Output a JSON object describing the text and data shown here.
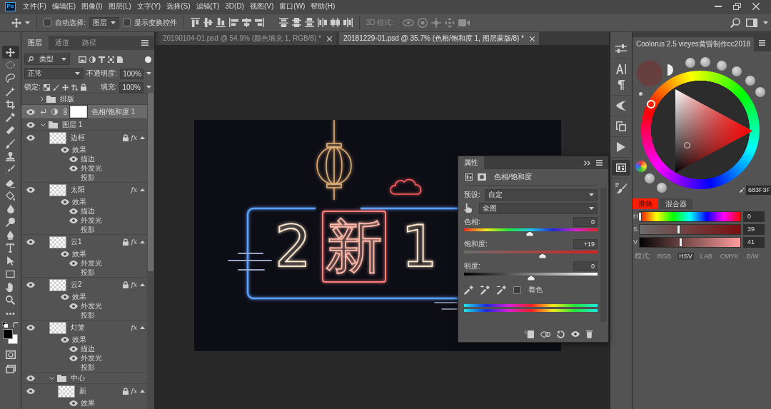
{
  "menu_bar": {
    "logo": "Ps",
    "items": [
      "文件(F)",
      "编辑(E)",
      "图像(I)",
      "图层(L)",
      "文字(Y)",
      "选择(S)",
      "滤镜(T)",
      "3D(D)",
      "视图(V)",
      "窗口(W)",
      "帮助(H)"
    ]
  },
  "options_bar": {
    "auto_select": {
      "label": "自动选择:",
      "checked": false
    },
    "auto_select_target": "图层",
    "transform_controls": {
      "label": "显示变换控件",
      "checked": false
    },
    "mode_3d_label": "3D 模式:"
  },
  "document_tabs": [
    {
      "title": "20190104-01.psd @ 54.9% (颜色填充 1, RGB/8) *",
      "selected": false
    },
    {
      "title": "20181229-01.psd @ 35.7% (色相/饱和度 1, 图层蒙版/8) *",
      "selected": true
    }
  ],
  "tools": [
    {
      "selected": true
    },
    {
      "selected": false
    },
    {
      "selected": false
    },
    {
      "selected": false
    },
    {
      "selected": false
    },
    {
      "selected": false
    },
    {
      "selected": false
    },
    {
      "selected": false
    },
    {
      "selected": false
    },
    {
      "selected": false
    },
    {
      "selected": false
    },
    {
      "selected": false
    },
    {
      "selected": false
    },
    {
      "selected": false
    },
    {
      "selected": false
    },
    {
      "selected": false
    },
    {
      "selected": false
    },
    {
      "selected": false
    },
    {
      "selected": false
    },
    {
      "selected": false
    },
    {
      "selected": false
    }
  ],
  "layers_panel": {
    "tabs": [
      {
        "label": "图层",
        "selected": true
      },
      {
        "label": "通道",
        "selected": false
      },
      {
        "label": "路径",
        "selected": false
      }
    ],
    "filter": "类型",
    "blend_mode": "正常",
    "opacity_label": "不透明度:",
    "opacity": "100%",
    "lock_label": "锁定:",
    "fill_label": "填充:",
    "fill": "100%",
    "layers": [
      {
        "kind": "group",
        "name": "排版",
        "visible": false,
        "selected": false,
        "locked": false,
        "expanded": false
      },
      {
        "kind": "adjustment",
        "name": "色相/饱和度 1",
        "visible": true,
        "selected": true,
        "locked": false
      },
      {
        "kind": "group",
        "name": "图层 1",
        "visible": true,
        "selected": false,
        "locked": false,
        "expanded": true,
        "children": [
          {
            "kind": "layer",
            "name": "边框",
            "visible": true,
            "selected": false,
            "locked": true,
            "expanded": true,
            "badge": "fx",
            "effects": {
              "label": "效果",
              "visible": true,
              "items": [
                {
                  "name": "描边",
                  "visible": true
                },
                {
                  "name": "外发光",
                  "visible": true
                },
                {
                  "name": "投影",
                  "visible": false
                }
              ]
            }
          },
          {
            "kind": "layer",
            "name": "太阳",
            "visible": true,
            "selected": false,
            "locked": false,
            "expanded": true,
            "badge": "fx",
            "effects": {
              "label": "效果",
              "visible": true,
              "items": [
                {
                  "name": "描边",
                  "visible": true
                },
                {
                  "name": "外发光",
                  "visible": true
                },
                {
                  "name": "投影",
                  "visible": false
                }
              ]
            }
          },
          {
            "kind": "layer",
            "name": "云1",
            "visible": true,
            "selected": false,
            "locked": true,
            "expanded": true,
            "badge": "fx",
            "effects": {
              "label": "效果",
              "visible": true,
              "items": [
                {
                  "name": "外发光",
                  "visible": true
                },
                {
                  "name": "投影",
                  "visible": false
                }
              ]
            }
          },
          {
            "kind": "layer",
            "name": "云2",
            "visible": true,
            "selected": false,
            "locked": true,
            "expanded": true,
            "badge": "fx",
            "effects": {
              "label": "效果",
              "visible": true,
              "items": [
                {
                  "name": "外发光",
                  "visible": true
                },
                {
                  "name": "投影",
                  "visible": false
                }
              ]
            }
          },
          {
            "kind": "layer",
            "name": "灯笼",
            "visible": true,
            "selected": false,
            "locked": false,
            "expanded": true,
            "badge": "fx",
            "effects": {
              "label": "效果",
              "visible": true,
              "items": [
                {
                  "name": "描边",
                  "visible": true
                },
                {
                  "name": "外发光",
                  "visible": true
                },
                {
                  "name": "投影",
                  "visible": false
                }
              ]
            }
          },
          {
            "kind": "group",
            "name": "中心",
            "visible": true,
            "selected": false,
            "locked": false,
            "expanded": true,
            "children": [
              {
                "kind": "layer",
                "name": "新",
                "visible": true,
                "selected": false,
                "locked": true,
                "expanded": true,
                "badge": "fx",
                "effects": {
                  "label": "效果",
                  "visible": true
                }
              }
            ]
          }
        ]
      }
    ]
  },
  "canvas": {
    "artwork": [
      {
        "text": "2",
        "framed": false
      },
      {
        "text": "新",
        "framed": true
      },
      {
        "text": "1",
        "framed": false
      }
    ]
  },
  "properties_panel": {
    "title": "属性",
    "view_tabs": [
      {
        "selected": true
      },
      {
        "selected": false
      }
    ],
    "adjustment_title": "色相/饱和度",
    "preset_label": "预设:",
    "preset": "自定",
    "range": "全图",
    "sliders": [
      {
        "kind": "hue",
        "label": "色相:",
        "value": "0",
        "level": 0.49
      },
      {
        "kind": "saturation",
        "label": "饱和度:",
        "value": "+19",
        "level": 0.59
      },
      {
        "kind": "lightness",
        "label": "明度:",
        "value": "0",
        "level": 0.5
      }
    ],
    "colorize": {
      "label": "着色",
      "checked": false
    }
  },
  "dock_icons": [
    {
      "selected": false
    },
    {
      "selected": false
    },
    {
      "selected": false
    },
    {
      "selected": false
    },
    {
      "selected": false
    },
    {
      "selected": false
    },
    {
      "selected": true
    },
    {
      "selected": false
    }
  ],
  "coolorus": {
    "title": "Coolorus 2.5 vieyes黄昏制作cc2018",
    "hex": "683F3F",
    "tabs": [
      {
        "label": "滑块",
        "selected": true
      },
      {
        "label": "混合器",
        "selected": false
      }
    ],
    "sliders": [
      {
        "kind": "hue",
        "label": "H",
        "value": "0",
        "level": 0.01
      },
      {
        "kind": "saturation",
        "label": "S",
        "value": "39",
        "level": 0.39
      },
      {
        "kind": "value",
        "label": "V",
        "value": "41",
        "level": 0.41
      }
    ],
    "modes_label": "模式:",
    "modes": [
      {
        "label": "RGB",
        "selected": false
      },
      {
        "label": "HSV",
        "selected": true
      },
      {
        "label": "LAB",
        "selected": false
      },
      {
        "label": "CMYK",
        "selected": false
      },
      {
        "label": "B/W",
        "selected": false
      }
    ]
  }
}
